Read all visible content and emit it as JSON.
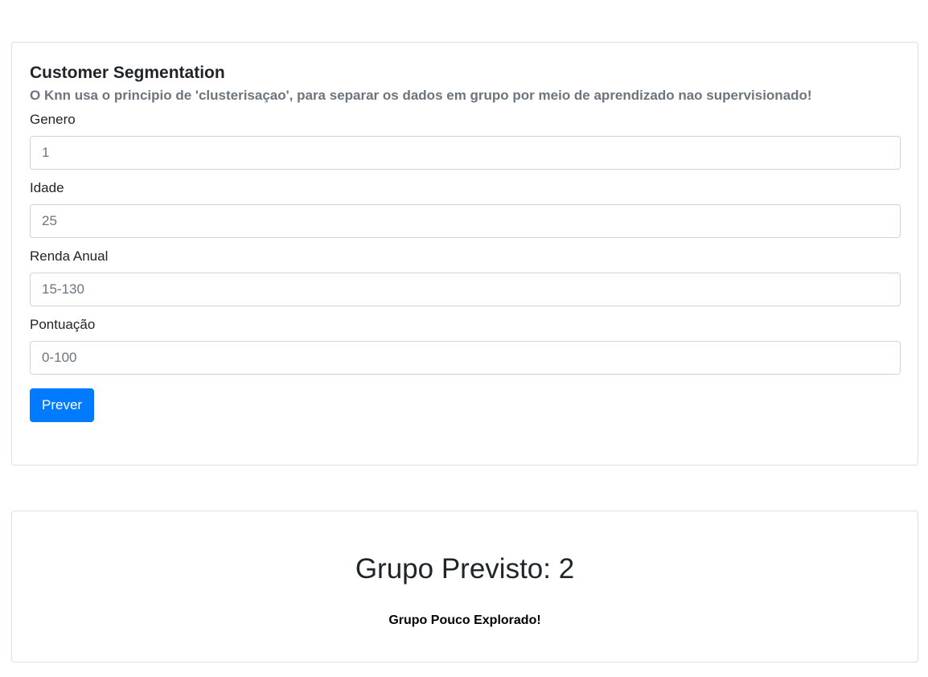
{
  "form": {
    "title": "Customer Segmentation",
    "subtitle": "O Knn usa o principio de 'clusterisaçao', para separar os dados em grupo por meio de aprendizado nao supervisionado!",
    "fields": [
      {
        "label": "Genero",
        "placeholder": "1"
      },
      {
        "label": "Idade",
        "placeholder": "25"
      },
      {
        "label": "Renda Anual",
        "placeholder": "15-130"
      },
      {
        "label": "Pontuação",
        "placeholder": "0-100"
      }
    ],
    "submit_label": "Prever"
  },
  "result": {
    "title": "Grupo Previsto: 2",
    "description": "Grupo Pouco Explorado!"
  },
  "colors": {
    "primary": "#007bff",
    "muted": "#6c757d",
    "border": "#dfdfdf"
  }
}
